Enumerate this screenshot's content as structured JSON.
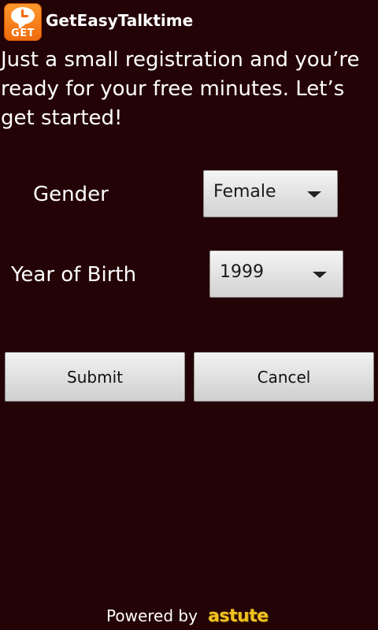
{
  "app": {
    "title": "GetEasyTalktime",
    "logo_text": "GET",
    "logo_icon": "talk-clock-bubble-icon"
  },
  "intro": {
    "text": "Just a small registration and you’re ready for your free minutes. Let’s get started!"
  },
  "form": {
    "gender": {
      "label": "Gender",
      "selected": "Female"
    },
    "year_of_birth": {
      "label": "Year of Birth",
      "selected": "1999"
    }
  },
  "buttons": {
    "submit_label": "Submit",
    "cancel_label": "Cancel"
  },
  "footer": {
    "powered_by": "Powered by",
    "brand": "astute"
  },
  "colors": {
    "background": "#240306",
    "logo_orange": "#f06a0c",
    "brand_yellow": "#f0c020",
    "text": "#ffffff"
  }
}
